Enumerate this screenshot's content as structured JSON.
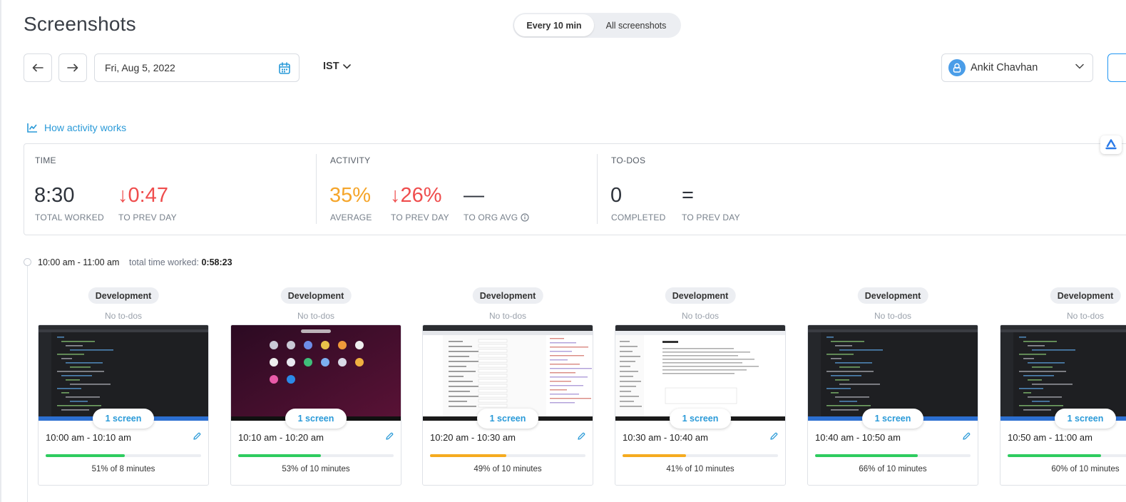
{
  "page": {
    "title": "Screenshots",
    "toggle": {
      "active": "Every 10 min",
      "inactive": "All screenshots"
    },
    "date": "Fri, Aug 5, 2022",
    "timezone": "IST",
    "user": "Ankit Chavhan",
    "how_link": "How activity works"
  },
  "stats": {
    "time": {
      "head": "TIME",
      "value": "8:30",
      "value_label": "TOTAL WORKED",
      "delta": "↓0:47",
      "delta_label": "TO PREV DAY"
    },
    "activity": {
      "head": "ACTIVITY",
      "value": "35%",
      "value_label": "AVERAGE",
      "delta": "↓26%",
      "delta_label": "TO PREV DAY",
      "org": "—",
      "org_label": "TO ORG AVG"
    },
    "todos": {
      "head": "TO-DOS",
      "value": "0",
      "value_label": "COMPLETED",
      "delta": "=",
      "delta_label": "TO PREV DAY"
    },
    "colors": {
      "negative": "#ef4d4d",
      "activity": "#f5a52a"
    }
  },
  "hour": {
    "range": "10:00 am - 11:00 am",
    "total_label": "total time worked:",
    "total_value": "0:58:23"
  },
  "slots": [
    {
      "tag": "Development",
      "todos": "No to-dos",
      "screens": "1 screen",
      "time": "10:00 am - 10:10 am",
      "pct_text": "51% of 8 minutes",
      "activity": 0.51,
      "color": "#2ecc5f",
      "thumb": "code-editor"
    },
    {
      "tag": "Development",
      "todos": "No to-dos",
      "screens": "1 screen",
      "time": "10:10 am - 10:20 am",
      "pct_text": "53% of 10 minutes",
      "activity": 0.53,
      "color": "#2ecc5f",
      "thumb": "desktop-apps"
    },
    {
      "tag": "Development",
      "todos": "No to-dos",
      "screens": "1 screen",
      "time": "10:20 am - 10:30 am",
      "pct_text": "49% of 10 minutes",
      "activity": 0.49,
      "color": "#f5ab1f",
      "thumb": "browser-form"
    },
    {
      "tag": "Development",
      "todos": "No to-dos",
      "screens": "1 screen",
      "time": "10:30 am - 10:40 am",
      "pct_text": "41% of 10 minutes",
      "activity": 0.41,
      "color": "#f5ab1f",
      "thumb": "docs-page"
    },
    {
      "tag": "Development",
      "todos": "No to-dos",
      "screens": "1 screen",
      "time": "10:40 am - 10:50 am",
      "pct_text": "66% of 10 minutes",
      "activity": 0.66,
      "color": "#2ecc5f",
      "thumb": "code-editor"
    },
    {
      "tag": "Development",
      "todos": "No to-dos",
      "screens": "1 screen",
      "time": "10:50 am - 11:00 am",
      "pct_text": "60% of 10 minutes",
      "activity": 0.6,
      "color": "#2ecc5f",
      "thumb": "code-editor"
    }
  ]
}
